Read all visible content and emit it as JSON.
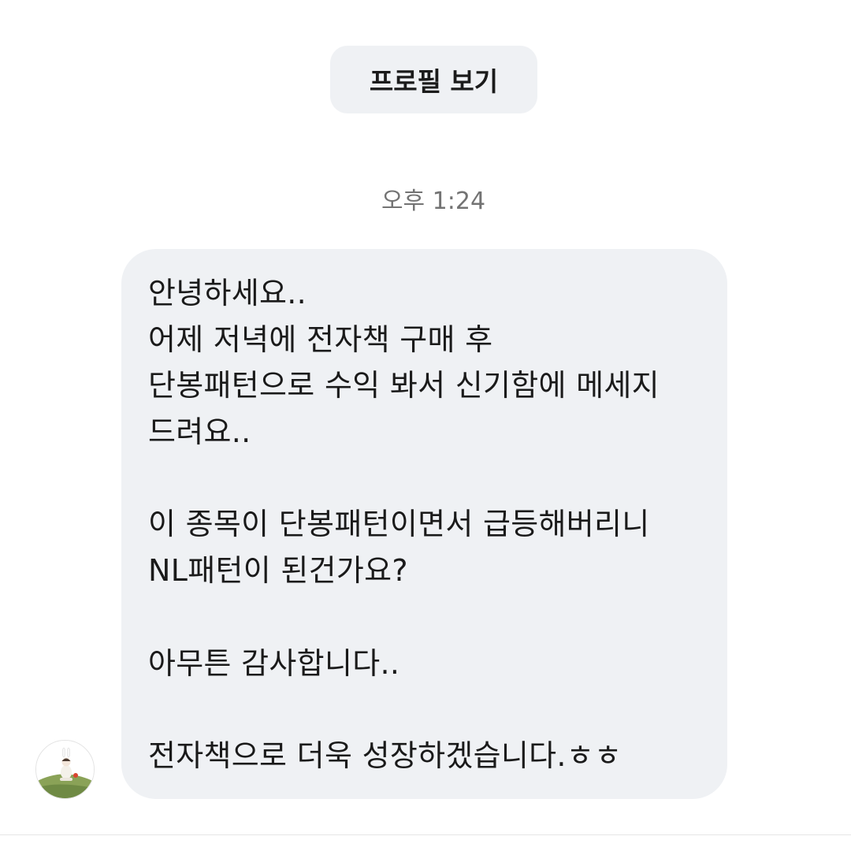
{
  "header": {
    "profile_button_label": "프로필 보기"
  },
  "thread": {
    "timestamp": "오후 1:24"
  },
  "message": {
    "lines": [
      "안녕하세요..",
      "어제 저녁에 전자책 구매 후",
      "단봉패턴으로 수익 봐서 신기함에 메세지",
      "드려요..",
      "",
      "이 종목이 단봉패턴이면서 급등해버리니",
      "NL패턴이 된건가요?",
      "",
      "아무튼 감사합니다..",
      "",
      "전자책으로 더욱 성장하겠습니다.ㅎㅎ"
    ]
  },
  "sender": {
    "avatar_icon": "user-avatar-photo"
  },
  "colors": {
    "background": "#ffffff",
    "bubble": "#eff1f4",
    "text": "#1a1a1a",
    "timestamp": "#737373"
  }
}
